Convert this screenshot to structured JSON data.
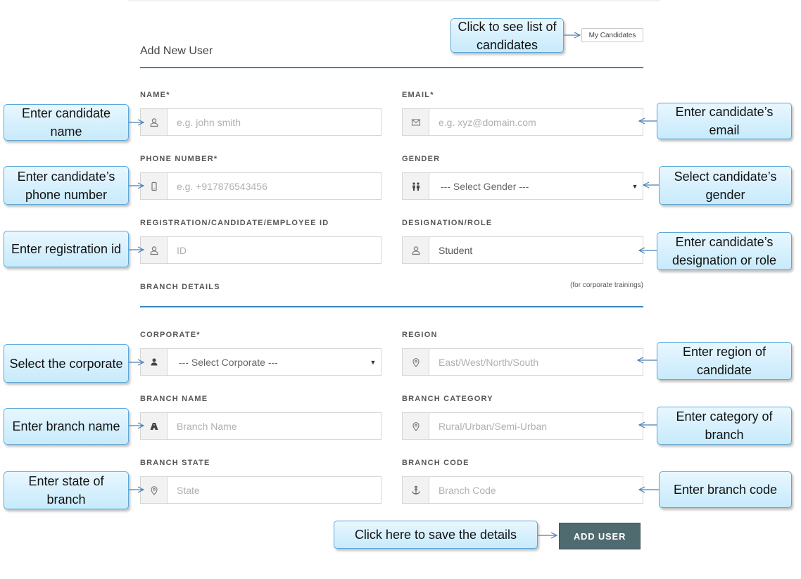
{
  "header": {
    "title": "Add New User",
    "my_candidates_label": "My Candidates"
  },
  "fields": {
    "name": {
      "label": "NAME*",
      "placeholder": "e.g. john smith",
      "icon": "user-icon"
    },
    "email": {
      "label": "EMAIL*",
      "placeholder": "e.g. xyz@domain.com",
      "icon": "envelope-icon"
    },
    "phone": {
      "label": "PHONE NUMBER*",
      "placeholder": "e.g. +917876543456",
      "icon": "mobile-icon"
    },
    "gender": {
      "label": "GENDER",
      "value": "--- Select Gender ---",
      "icon": "people-icon"
    },
    "registration_id": {
      "label": "REGISTRATION/CANDIDATE/EMPLOYEE ID",
      "placeholder": "ID",
      "icon": "user-icon"
    },
    "designation": {
      "label": "DESIGNATION/ROLE",
      "value": "Student",
      "icon": "user-icon"
    },
    "corporate": {
      "label": "CORPORATE*",
      "value": "--- Select Corporate ---",
      "icon": "user-solid-icon"
    },
    "region": {
      "label": "REGION",
      "placeholder": "East/West/North/South",
      "icon": "location-pin-icon"
    },
    "branch_name": {
      "label": "BRANCH NAME",
      "placeholder": "Branch Name",
      "icon": "road-icon"
    },
    "branch_category": {
      "label": "BRANCH CATEGORY",
      "placeholder": "Rural/Urban/Semi-Urban",
      "icon": "location-pin-icon"
    },
    "branch_state": {
      "label": "BRANCH STATE",
      "placeholder": "State",
      "icon": "location-pin-icon"
    },
    "branch_code": {
      "label": "BRANCH CODE",
      "placeholder": "Branch Code",
      "icon": "anchor-icon"
    }
  },
  "branch_section": {
    "title": "BRANCH DETAILS",
    "note": "(for corporate trainings)"
  },
  "submit": {
    "label": "ADD USER"
  },
  "callouts": {
    "my_candidates": "Click to see list of candidates",
    "name": "Enter candidate name",
    "email": "Enter candidate’s email",
    "phone": "Enter candidate’s phone number",
    "gender": "Select candidate’s gender",
    "registration": "Enter registration id",
    "designation": "Enter candidate’s designation or role",
    "corporate": "Select the corporate",
    "region": "Enter region of candidate",
    "branch_name": "Enter branch name",
    "branch_category": "Enter category of branch",
    "branch_state": "Enter state of branch",
    "branch_code": "Enter branch code",
    "save": "Click here to save the details"
  },
  "colors": {
    "accent": "#3a86c8",
    "button": "#4f6b70",
    "callout_border": "#5da8d8",
    "callout_fill": "#c7eafb"
  }
}
